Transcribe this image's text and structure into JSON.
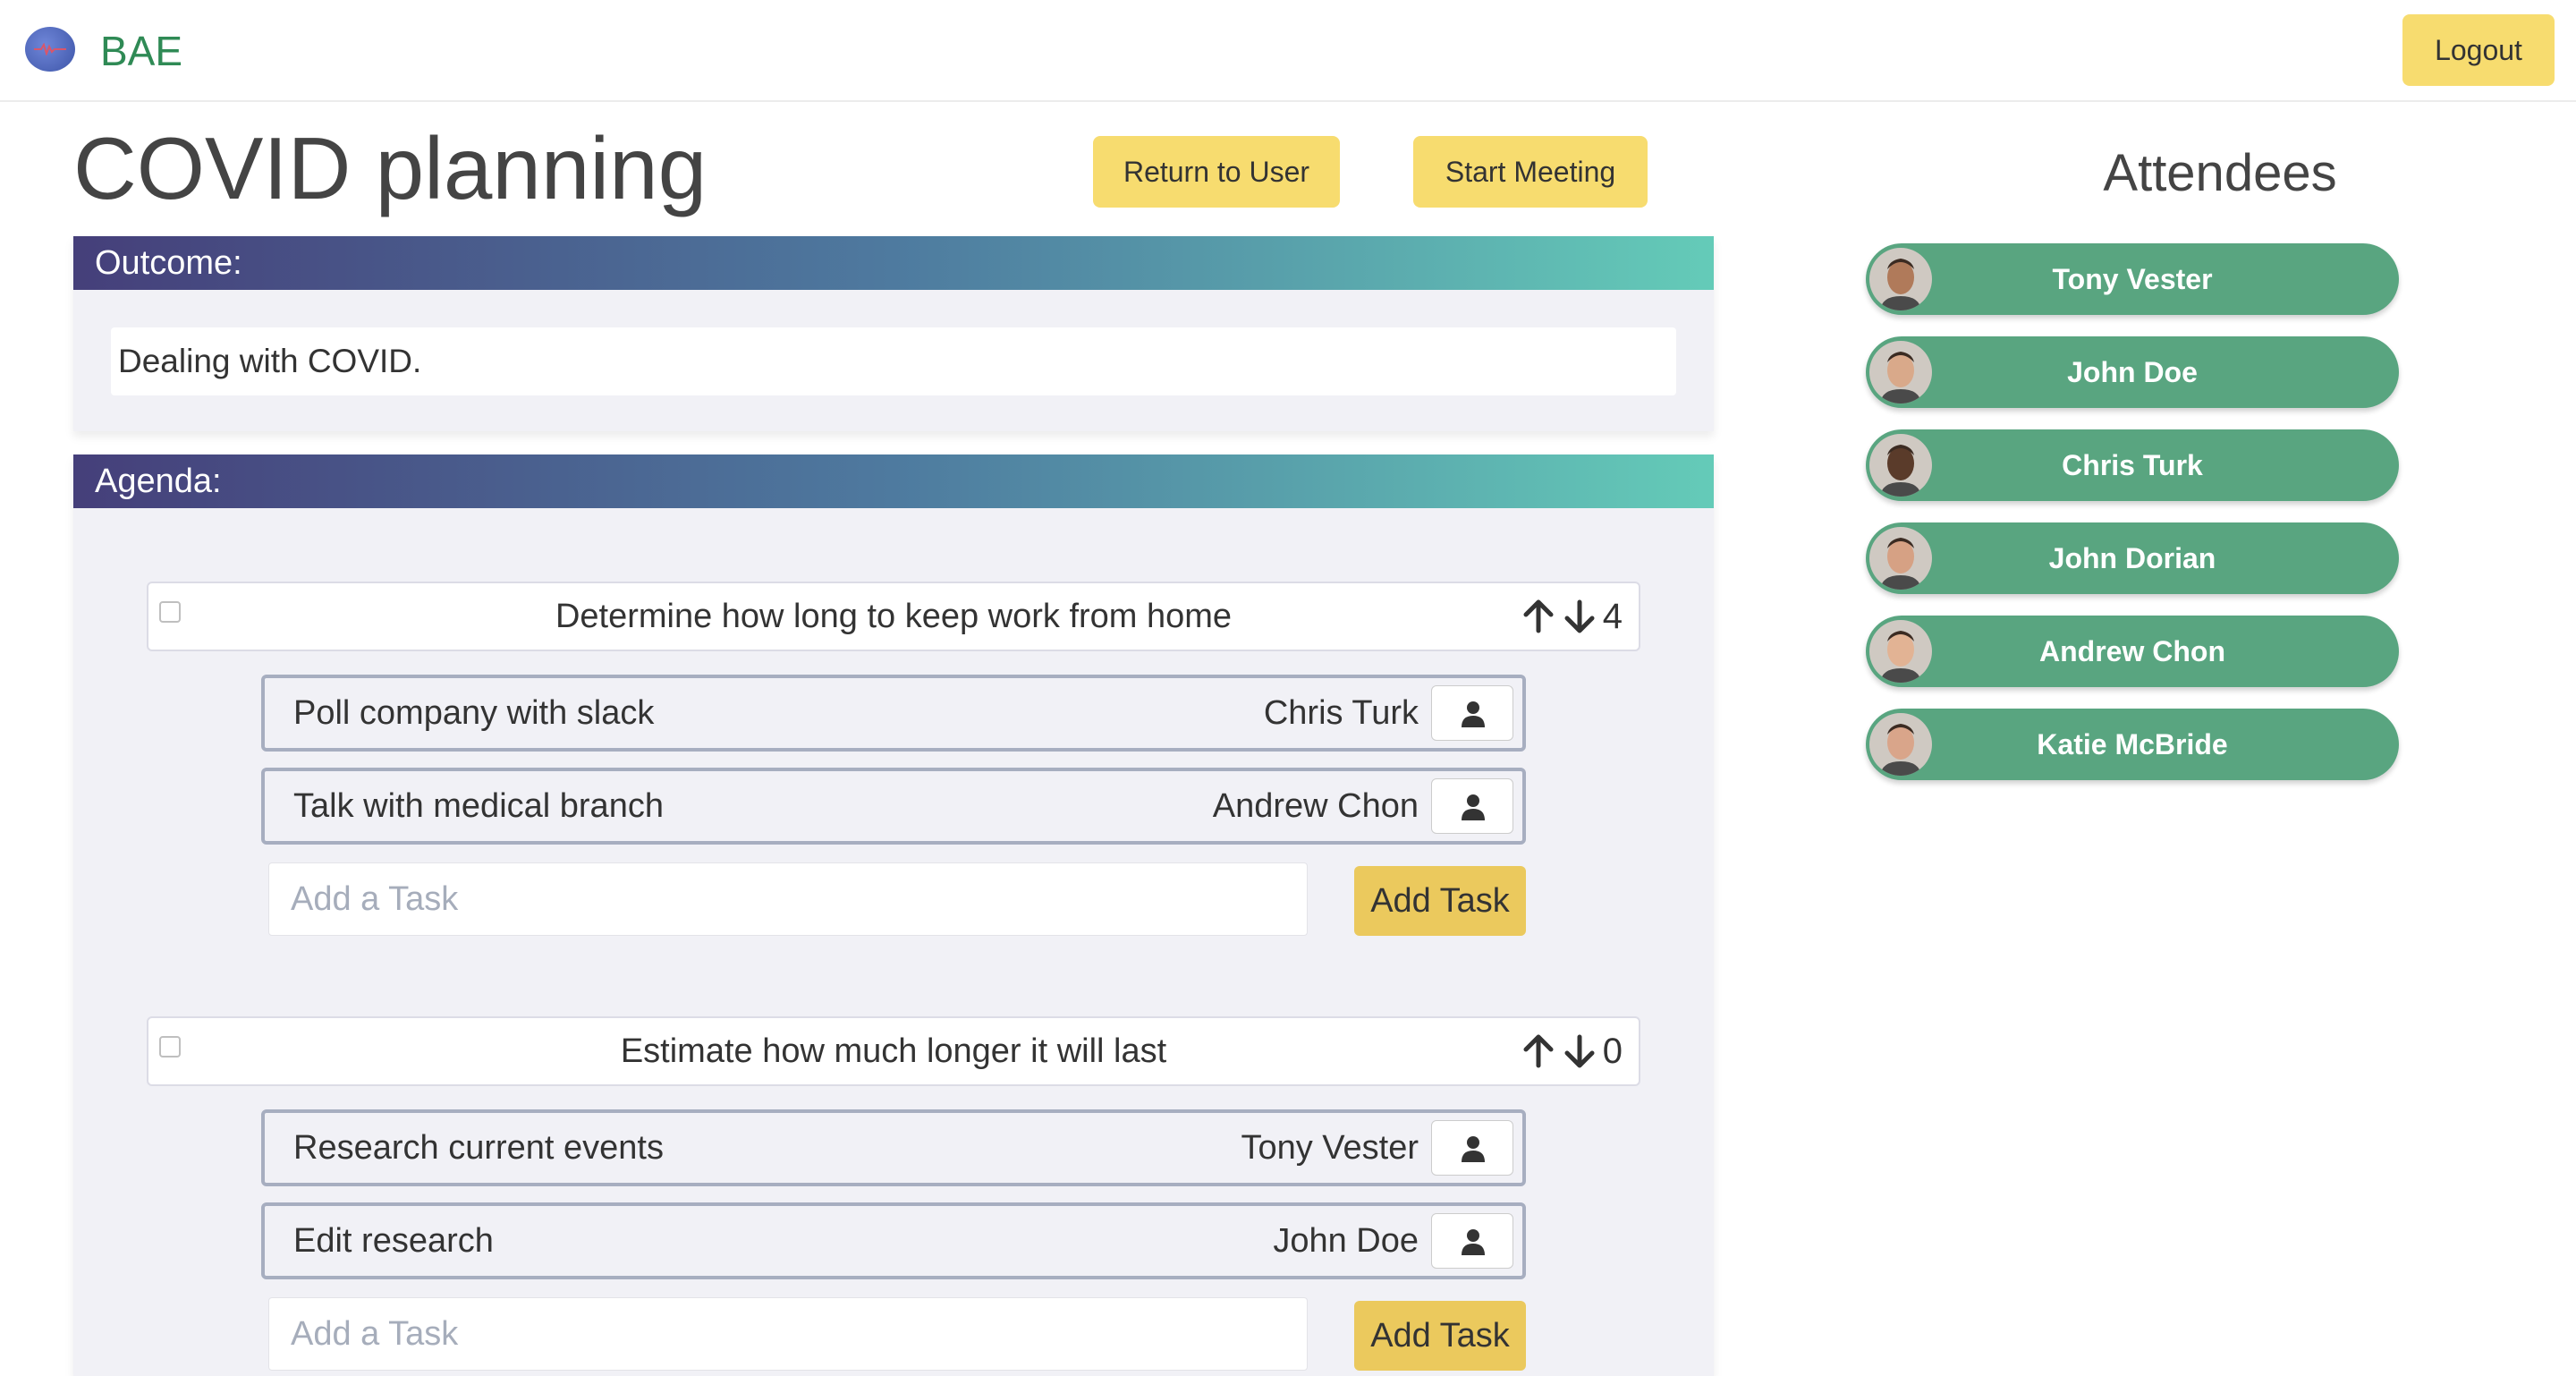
{
  "brand": {
    "name": "BAE",
    "logo_icon": "heartbeat-logo-icon"
  },
  "navbar": {
    "logout_label": "Logout"
  },
  "header": {
    "title": "COVID planning",
    "return_label": "Return to User",
    "start_label": "Start Meeting"
  },
  "outcome": {
    "heading": "Outcome:",
    "text": "Dealing with COVID."
  },
  "agenda": {
    "heading": "Agenda:",
    "items": [
      {
        "title": "Determine how long to keep work from home",
        "votes": "4",
        "tasks": [
          {
            "name": "Poll company with slack",
            "assignee": "Chris Turk"
          },
          {
            "name": "Talk with medical branch",
            "assignee": "Andrew Chon"
          }
        ],
        "add_placeholder": "Add a Task",
        "add_label": "Add Task"
      },
      {
        "title": "Estimate how much longer it will last",
        "votes": "0",
        "tasks": [
          {
            "name": "Research current events",
            "assignee": "Tony Vester"
          },
          {
            "name": "Edit research",
            "assignee": "John Doe"
          }
        ],
        "add_placeholder": "Add a Task",
        "add_label": "Add Task"
      }
    ]
  },
  "attendees": {
    "title": "Attendees",
    "list": [
      {
        "name": "Tony Vester",
        "skin": "#b07a5a"
      },
      {
        "name": "John Doe",
        "skin": "#d9a98a"
      },
      {
        "name": "Chris Turk",
        "skin": "#5a3b2a"
      },
      {
        "name": "John Dorian",
        "skin": "#d6a184"
      },
      {
        "name": "Andrew Chon",
        "skin": "#e2b394"
      },
      {
        "name": "Katie McBride",
        "skin": "#d9a58a"
      }
    ]
  },
  "colors": {
    "accent_yellow": "#f7dc6f",
    "attendee_green": "#59a580",
    "brand_green": "#2f8a55",
    "header_gradient": [
      "#453f7a",
      "#4e7a9f",
      "#64cbb8"
    ]
  }
}
